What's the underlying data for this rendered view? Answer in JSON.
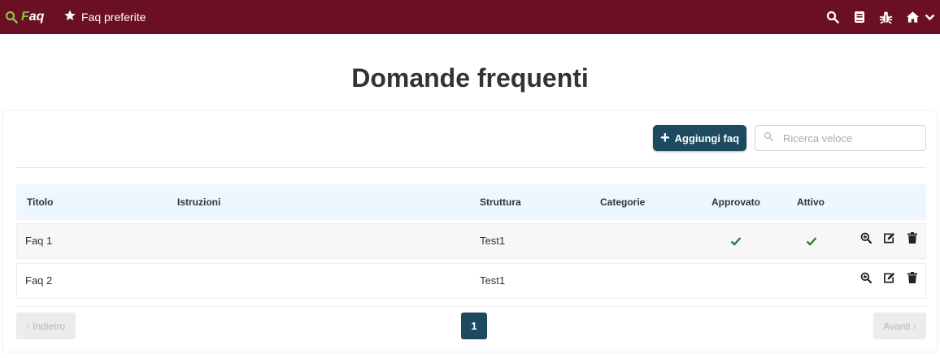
{
  "navbar": {
    "brand_first": "F",
    "brand_rest": "aq",
    "favorites_label": "Faq preferite",
    "icons": [
      "search-icon",
      "book-icon",
      "bug-icon",
      "home-icon",
      "chevron-down-icon"
    ],
    "background": "#6b0f25",
    "accent": "#8bc34a"
  },
  "page": {
    "title": "Domande frequenti"
  },
  "toolbar": {
    "add_label": "Aggiungi faq",
    "search_placeholder": "Ricerca veloce"
  },
  "table": {
    "columns": [
      "Titolo",
      "Istruzioni",
      "Struttura",
      "Categorie",
      "Approvato",
      "Attivo"
    ],
    "rows": [
      {
        "titolo": "Faq 1",
        "istruzioni": "",
        "struttura": "Test1",
        "categorie": "",
        "approvato": true,
        "attivo": true
      },
      {
        "titolo": "Faq 2",
        "istruzioni": "",
        "struttura": "Test1",
        "categorie": "",
        "approvato": false,
        "attivo": false
      }
    ],
    "row_actions": [
      "zoom-icon",
      "edit-icon",
      "trash-icon"
    ],
    "check_color": "#2e7d32"
  },
  "pagination": {
    "prev_label": "‹ Indietro",
    "next_label": "Avanti ›",
    "current_page": "1"
  },
  "colors": {
    "primary": "#1d4a5f",
    "header_bg": "#eef7ff"
  }
}
